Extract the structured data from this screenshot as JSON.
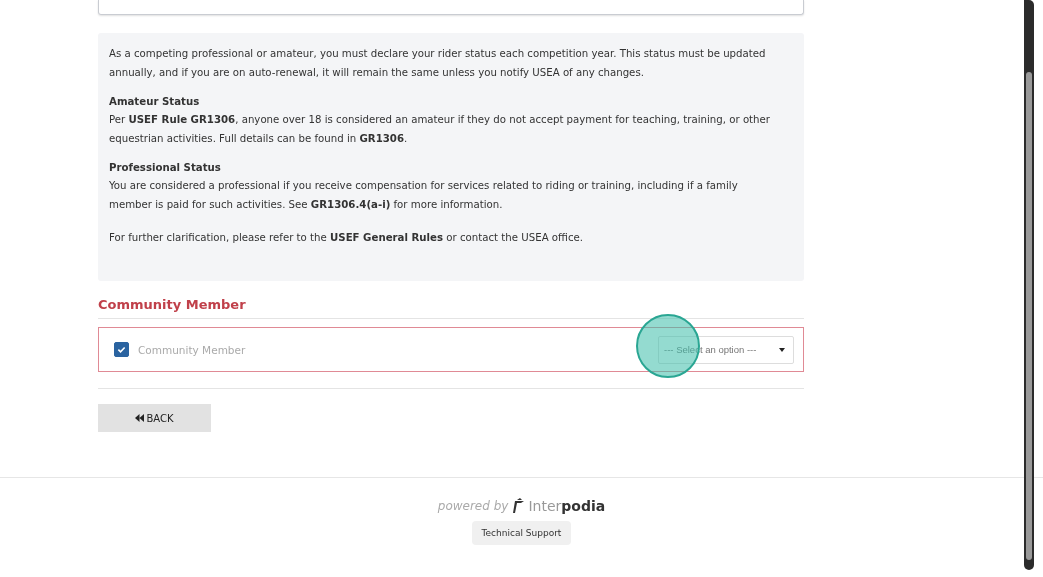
{
  "info": {
    "intro": "As a competing professional or amateur, you must declare your rider status each competition year. This status must be updated annually, and if you are on auto-renewal, it will remain the same unless you notify USEA of any changes.",
    "sections": [
      {
        "title": "Amateur Status",
        "text": "Per **USEF Rule GR1306**, anyone over 18 is considered an amateur if they do not accept payment for teaching, training, or other equestrian activities. Full details can be found in **GR1306**."
      },
      {
        "title": "Professional Status",
        "text": "You are considered a professional if you receive compensation for services related to riding or training, including if a family member is paid for such activities. See **GR1306.4(a-i)** for more information."
      }
    ],
    "closing": "For further clarification, please refer to the **USEF General Rules** or contact the USEA office."
  },
  "community": {
    "heading": "Community Member",
    "checkbox": {
      "label": "Community Member",
      "checked": true
    },
    "select": {
      "placeholder": "--- Select an option ---"
    }
  },
  "back_button": "BACK",
  "footer": {
    "powered_by": "powered by",
    "brand": "Inter**podia**",
    "support_button": "Technical Support"
  }
}
